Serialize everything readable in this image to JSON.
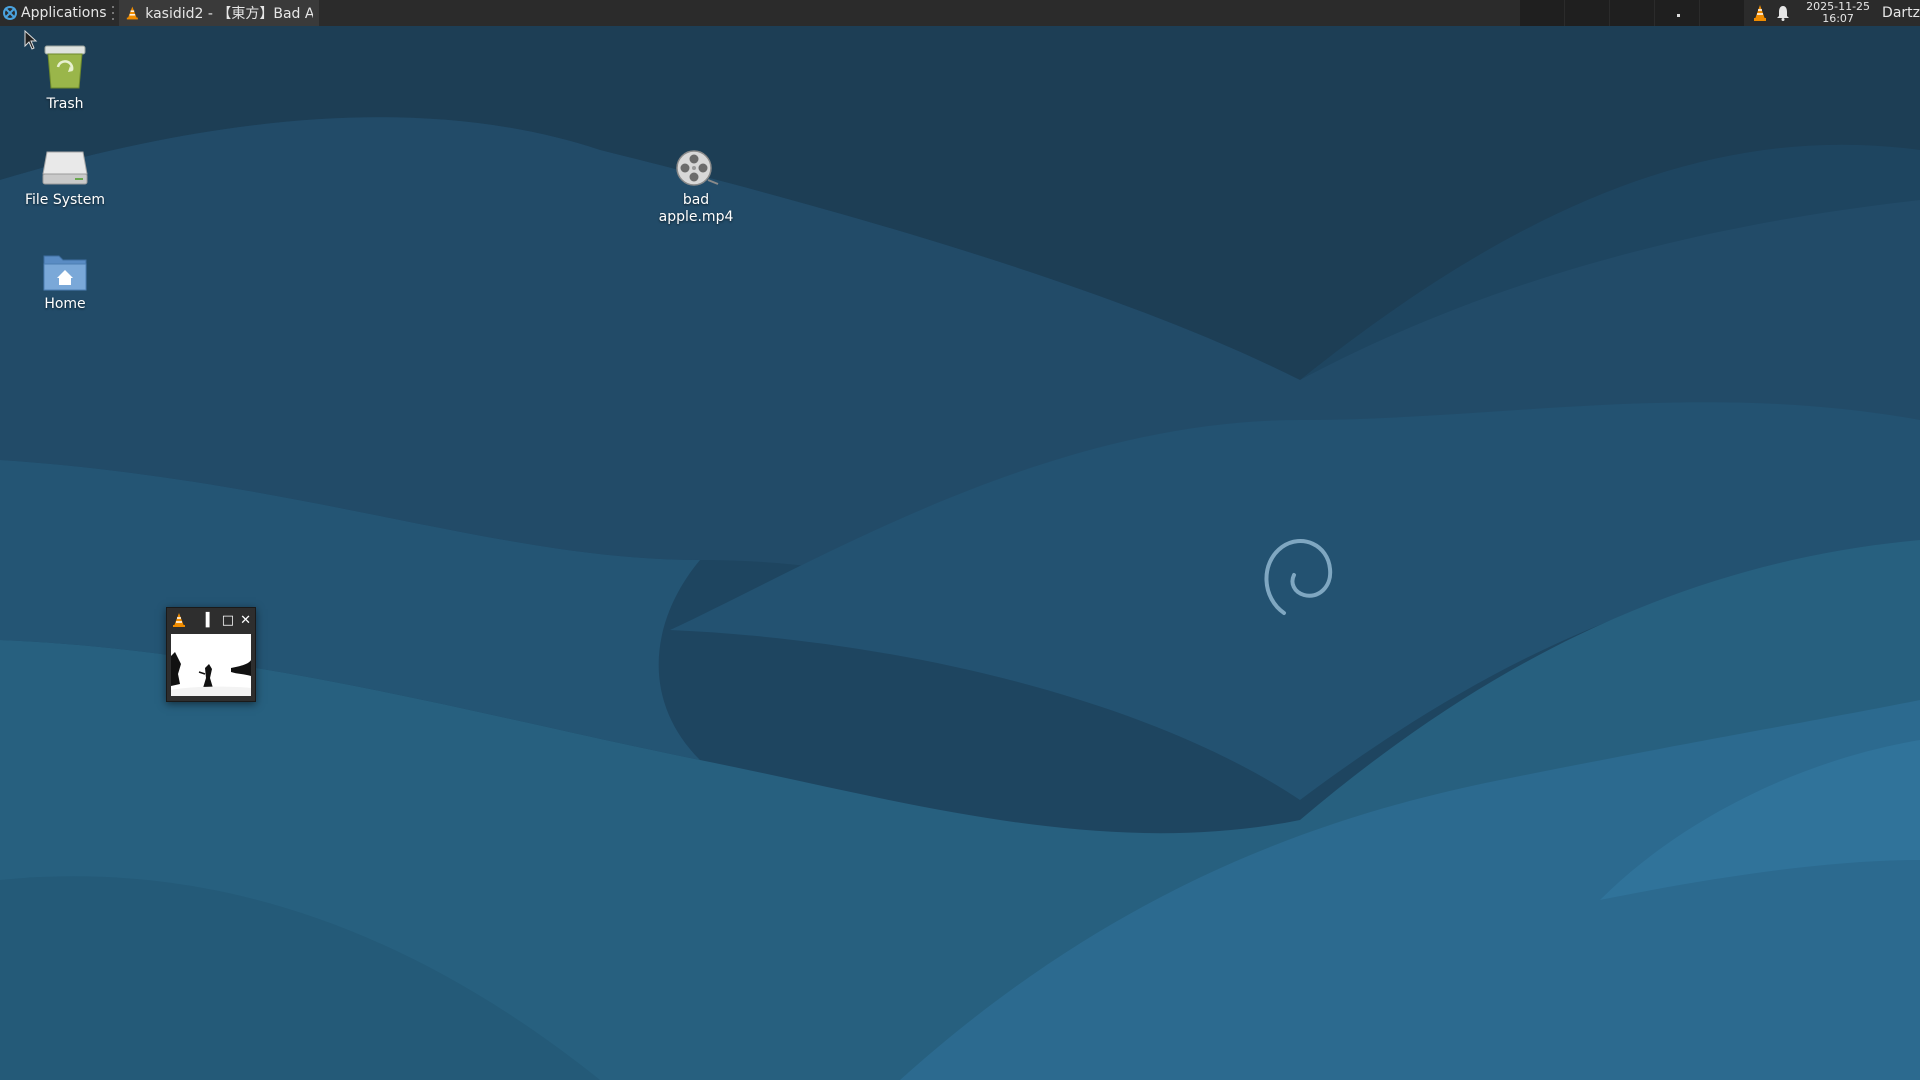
{
  "panel": {
    "applications_label": "Applications",
    "task_title": "kasidid2 - 【東方】Bad A...",
    "clock_date": "2025-11-25",
    "clock_time": "16:07",
    "user": "Dartz"
  },
  "desktop": {
    "icons": [
      {
        "label": "Trash",
        "icon": "trash-icon"
      },
      {
        "label": "File System",
        "icon": "drive-icon"
      },
      {
        "label": "Home",
        "icon": "home-folder-icon"
      },
      {
        "label": "bad\napple.mp4",
        "icon": "video-file-icon"
      }
    ]
  },
  "mini_player": {
    "app": "VLC media player",
    "controls": [
      "minimize",
      "maximize",
      "close"
    ]
  },
  "colors": {
    "panel_bg": "#2b2b2b",
    "wallpaper_dark": "#1c3c53",
    "wallpaper_light": "#2f6f96",
    "vlc_orange": "#f08c00"
  }
}
